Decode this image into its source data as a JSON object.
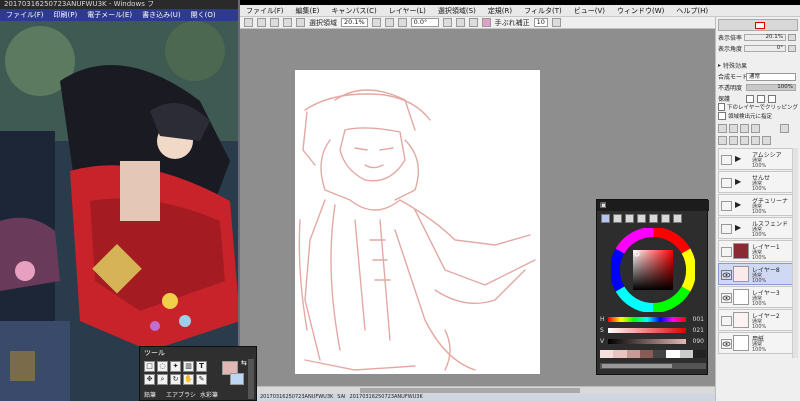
{
  "viewer": {
    "title": "20170316250723ANUFWU3K - Windows フ",
    "menu": [
      "ファイル(F)",
      "印刷(P)",
      "電子メール(E)",
      "書き込み(U)",
      "開く(O)"
    ]
  },
  "menu": [
    "ファイル(F)",
    "編集(E)",
    "キャンバス(C)",
    "レイヤー(L)",
    "選択領域(S)",
    "定規(R)",
    "フィルタ(T)",
    "ビュー(V)",
    "ウィンドウ(W)",
    "ヘルプ(H)"
  ],
  "toolbar": {
    "selection_label": "選択領域",
    "zoom": "20.1%",
    "angle": "0.0°",
    "stabilizer_label": "手ぶれ補正",
    "stabilizer_value": "10"
  },
  "nav": {
    "zoom_label": "表示倍率",
    "zoom_value": "20.1%",
    "angle_label": "表示角度",
    "angle_value": "0°"
  },
  "effects_title": "特殊効果",
  "layer_props": {
    "blend_label": "合成モード",
    "blend_value": "通常",
    "opacity_label": "不透明度",
    "opacity_value": "100%",
    "protect_label": "保護",
    "clip_label": "下のレイヤーでクリッピング",
    "source_label": "領域検出元に指定"
  },
  "layers": [
    {
      "name": "アムシシア",
      "mode": "通常",
      "opacity": "100%",
      "type": "folder"
    },
    {
      "name": "せんせ",
      "mode": "通常",
      "opacity": "100%",
      "type": "folder"
    },
    {
      "name": "グチュリーナ",
      "mode": "通常",
      "opacity": "100%",
      "type": "folder"
    },
    {
      "name": "ルスフェンド",
      "mode": "通常",
      "opacity": "100%",
      "type": "folder"
    },
    {
      "name": "レイヤー1",
      "mode": "通常",
      "opacity": "100%",
      "type": "layer"
    },
    {
      "name": "レイヤー8",
      "mode": "通常",
      "opacity": "100%",
      "type": "layer",
      "selected": true
    },
    {
      "name": "レイヤー3",
      "mode": "通常",
      "opacity": "100%",
      "type": "layer"
    },
    {
      "name": "レイヤー2",
      "mode": "通常",
      "opacity": "100%",
      "type": "layer"
    },
    {
      "name": "用紙",
      "mode": "通常",
      "opacity": "100%",
      "type": "layer"
    }
  ],
  "color": {
    "h_label": "H",
    "h_value": "001",
    "s_label": "S",
    "s_value": "021",
    "v_label": "V",
    "v_value": "090",
    "current": "#e0b7b4"
  },
  "tools": {
    "title": "ツール",
    "text_tool": "T",
    "brush_labels": [
      "鉛筆",
      "エアブラシ",
      "水彩筆"
    ]
  },
  "taskbar": [
    "20170316250723ANUFWU3K",
    "SAI",
    "20170316250723ANUFWU3K"
  ]
}
